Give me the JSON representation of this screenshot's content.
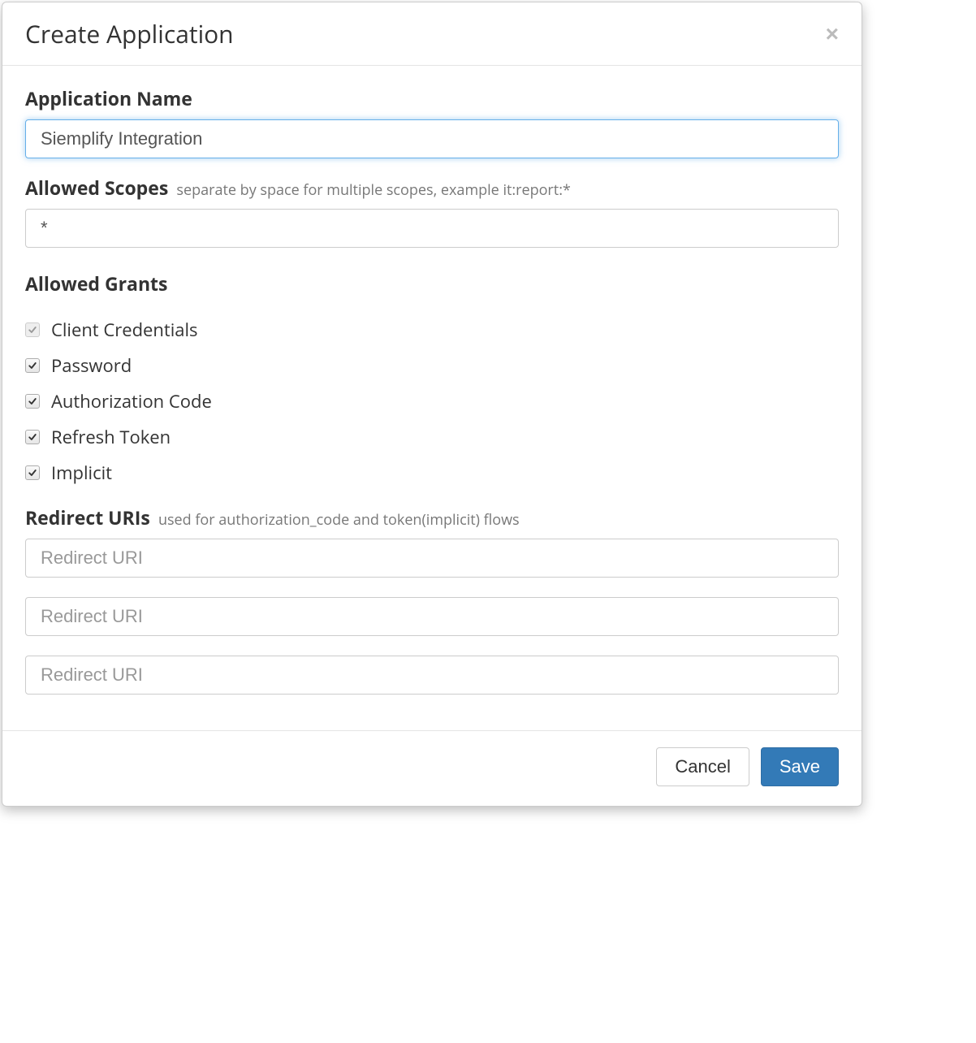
{
  "modal": {
    "title": "Create Application"
  },
  "form": {
    "app_name": {
      "label": "Application Name",
      "value": "Siemplify Integration"
    },
    "scopes": {
      "label": "Allowed Scopes",
      "hint": "separate by space for multiple scopes, example it:report:*",
      "value": "*"
    },
    "grants": {
      "label": "Allowed Grants",
      "items": [
        {
          "label": "Client Credentials",
          "checked": true,
          "disabled": true
        },
        {
          "label": "Password",
          "checked": true,
          "disabled": false
        },
        {
          "label": "Authorization Code",
          "checked": true,
          "disabled": false
        },
        {
          "label": "Refresh Token",
          "checked": true,
          "disabled": false
        },
        {
          "label": "Implicit",
          "checked": true,
          "disabled": false
        }
      ]
    },
    "redirects": {
      "label": "Redirect URIs",
      "hint": "used for authorization_code and token(implicit) flows",
      "placeholder": "Redirect URI",
      "items": [
        {
          "value": ""
        },
        {
          "value": ""
        },
        {
          "value": ""
        }
      ]
    }
  },
  "footer": {
    "cancel": "Cancel",
    "save": "Save"
  }
}
